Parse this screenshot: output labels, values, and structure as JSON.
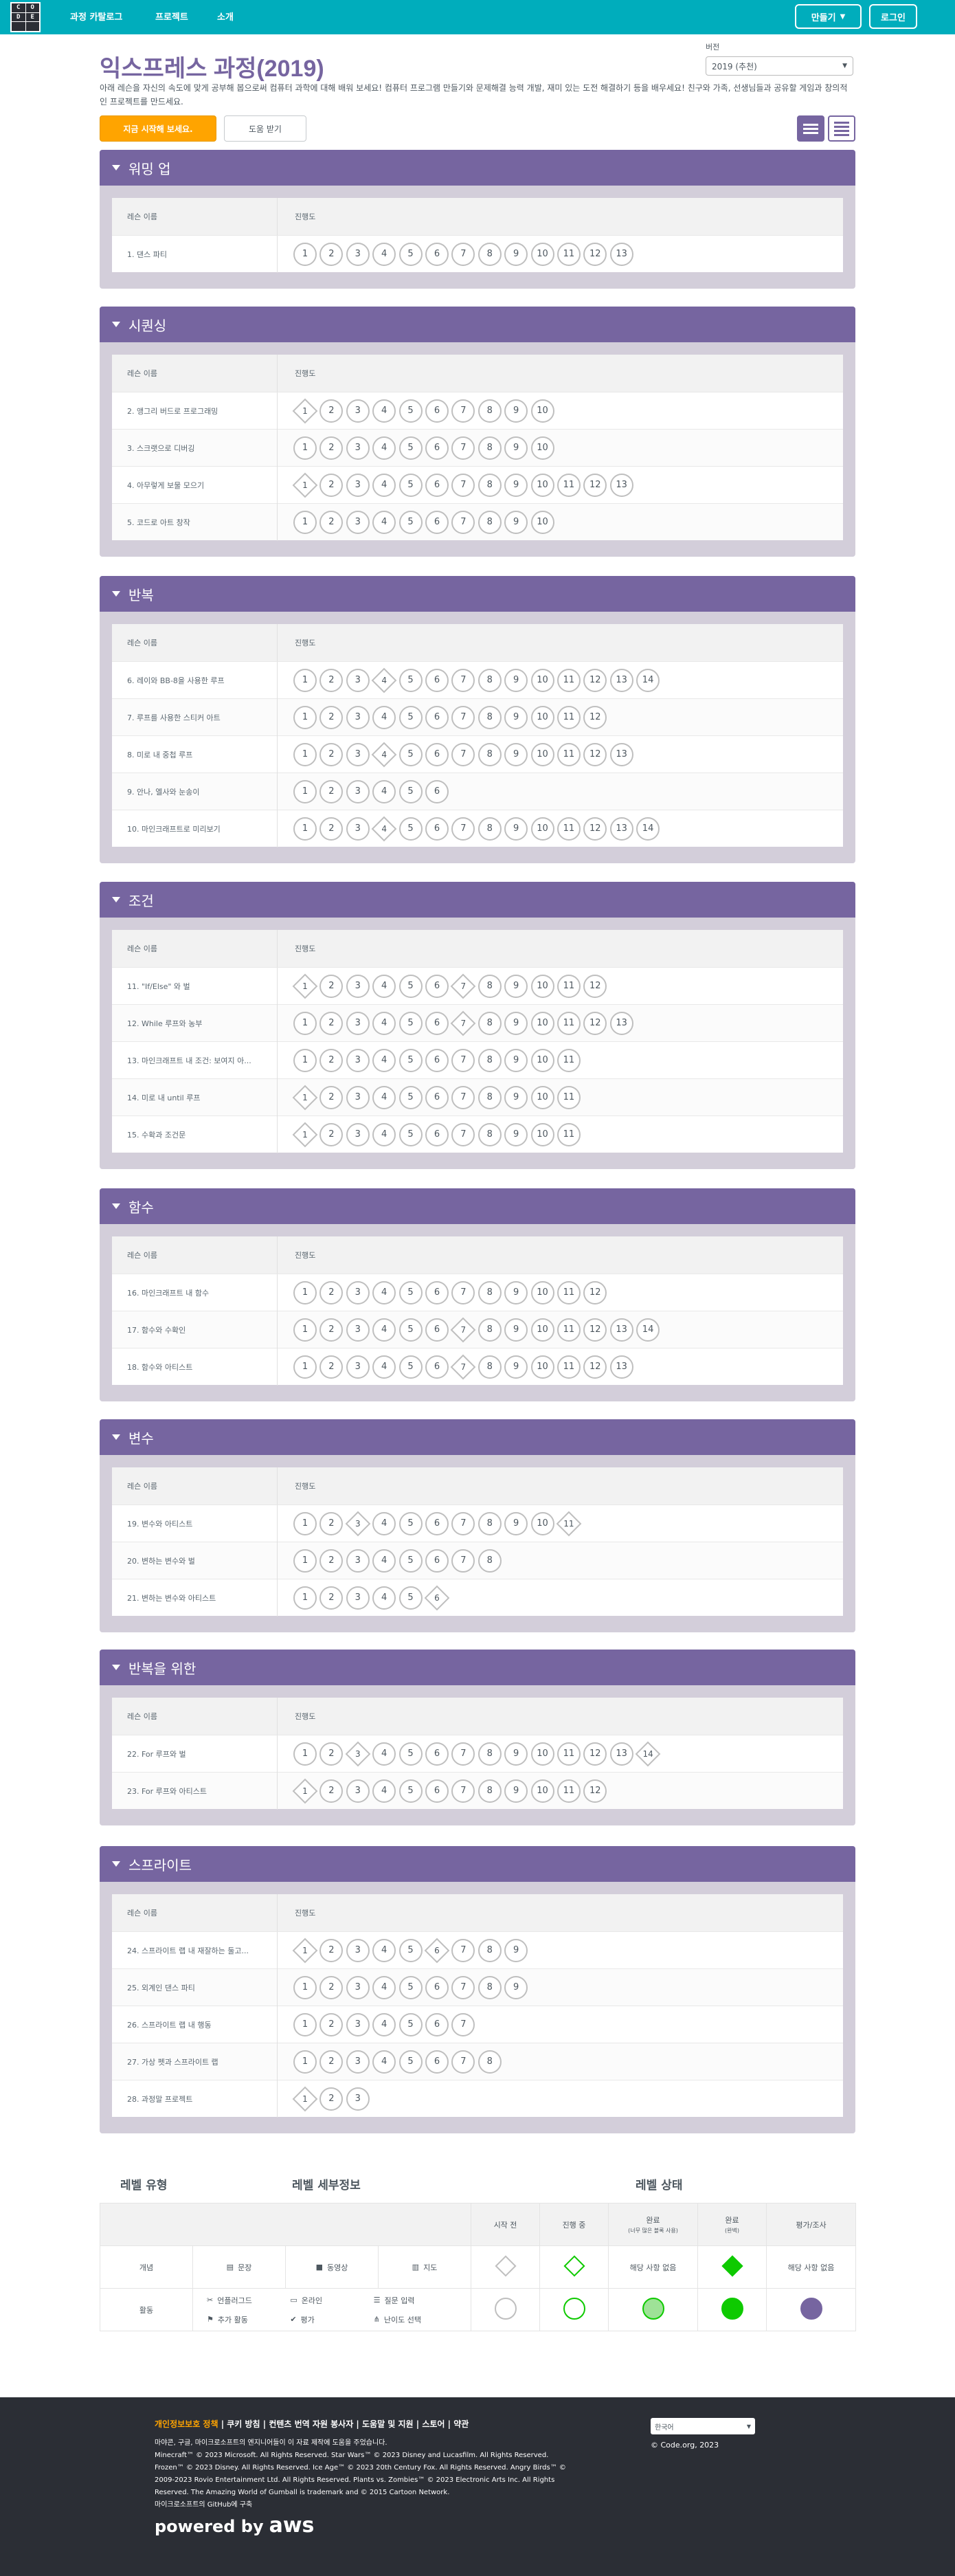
{
  "header": {
    "logo_letters": [
      "C",
      "O",
      "D",
      "E",
      "",
      ""
    ],
    "nav": [
      "과정 카탈로그",
      "프로젝트",
      "소개"
    ],
    "create_btn": "만들기",
    "signin_btn": "로그인"
  },
  "title_prefix": "익스프레스 과정",
  "title_year": "(2019)",
  "description": "아래 레슨을 자신의 속도에 맞게 공부해 봅으로써 컴퓨터 과학에 대해 배워 보세요! 컴퓨터 프로그램 만들기와 문제해결 능력 개발, 재미 있는 도전 해결하기 등을 배우세요! 친구와 가족, 선생님들과 공유할 게임과 창의적인 프로젝트를 만드세요.",
  "version": {
    "label": "버전",
    "selected": "2019 (추천)"
  },
  "buttons": {
    "start": "지금 시작해 보세요.",
    "help": "도움 받기"
  },
  "table_headers": {
    "lesson": "레슨 이름",
    "progress": "진행도"
  },
  "colors": {
    "header": "#00adbc",
    "unit": "#7665a0",
    "start": "#ffa400",
    "complete": "#0eca00"
  },
  "units": [
    {
      "title": "워밍 업",
      "lessons": [
        {
          "name": "1. 댄스 파티",
          "n": 13,
          "diamonds": []
        }
      ]
    },
    {
      "title": "시퀀싱",
      "lessons": [
        {
          "name": "2. 앵그리 버드로 프로그래밍",
          "n": 10,
          "diamonds": [
            1
          ]
        },
        {
          "name": "3. 스크랫으로 디버깅",
          "n": 10,
          "diamonds": []
        },
        {
          "name": "4. 아무렇게 보물 모으기",
          "n": 13,
          "diamonds": [
            1
          ]
        },
        {
          "name": "5. 코드로 아트 창작",
          "n": 10,
          "diamonds": []
        }
      ]
    },
    {
      "title": "반복",
      "lessons": [
        {
          "name": "6. 레이와 BB-8을 사용한 루프",
          "n": 14,
          "diamonds": [
            4
          ]
        },
        {
          "name": "7. 루프를 사용한 스티커 아트",
          "n": 12,
          "diamonds": []
        },
        {
          "name": "8. 미로 내 중첩 루프",
          "n": 13,
          "diamonds": [
            4
          ]
        },
        {
          "name": "9. 안나, 엘사와 눈송이",
          "n": 6,
          "diamonds": []
        },
        {
          "name": "10. 마인크래프트로 미리보기",
          "n": 14,
          "diamonds": [
            4
          ]
        }
      ]
    },
    {
      "title": "조건",
      "lessons": [
        {
          "name": "11. \"If/Else\" 와 벌",
          "n": 12,
          "diamonds": [
            1,
            7
          ]
        },
        {
          "name": "12. While 루프와 농부",
          "n": 13,
          "diamonds": [
            7
          ]
        },
        {
          "name": "13. 마인크래프트 내 조건: 보여지 아...",
          "n": 11,
          "diamonds": []
        },
        {
          "name": "14. 미로 내 until 루프",
          "n": 11,
          "diamonds": [
            1
          ]
        },
        {
          "name": "15. 수확과 조건문",
          "n": 11,
          "diamonds": [
            1
          ]
        }
      ]
    },
    {
      "title": "함수",
      "lessons": [
        {
          "name": "16. 마인크래프트 내 함수",
          "n": 12,
          "diamonds": []
        },
        {
          "name": "17. 함수와 수확인",
          "n": 14,
          "diamonds": [
            7
          ]
        },
        {
          "name": "18. 함수와 아티스트",
          "n": 13,
          "diamonds": [
            7
          ]
        }
      ]
    },
    {
      "title": "변수",
      "lessons": [
        {
          "name": "19. 변수와 아티스트",
          "n": 11,
          "diamonds": [
            3,
            11
          ]
        },
        {
          "name": "20. 변하는 변수와 벌",
          "n": 8,
          "diamonds": []
        },
        {
          "name": "21. 변하는 변수와 아티스트",
          "n": 6,
          "diamonds": [
            6
          ]
        }
      ]
    },
    {
      "title": "반복을 위한",
      "lessons": [
        {
          "name": "22. For 루프와 벌",
          "n": 14,
          "diamonds": [
            3,
            14
          ]
        },
        {
          "name": "23. For 루프와 아티스트",
          "n": 12,
          "diamonds": [
            1
          ]
        }
      ]
    },
    {
      "title": "스프라이트",
      "lessons": [
        {
          "name": "24. 스프라이트 랩 내 재잘하는 둘고...",
          "n": 9,
          "diamonds": [
            1,
            6
          ]
        },
        {
          "name": "25. 외계인 댄스 파티",
          "n": 9,
          "diamonds": []
        },
        {
          "name": "26. 스프라이트 랩 내 행동",
          "n": 7,
          "diamonds": []
        },
        {
          "name": "27. 가상 펫과 스프라이트 랩",
          "n": 8,
          "diamonds": []
        },
        {
          "name": "28. 과정말 프로젝트",
          "n": 3,
          "diamonds": [
            1
          ]
        }
      ]
    }
  ],
  "legend": {
    "level_type": "레벨 유형",
    "level_details": "레벨 세부정보",
    "level_status": "레벨 상태",
    "status_cols": [
      {
        "label": "시작 전",
        "sub": ""
      },
      {
        "label": "진행 중",
        "sub": ""
      },
      {
        "label": "완료",
        "sub": "(너무 많은 블록 사용)"
      },
      {
        "label": "완료",
        "sub": "(완벽)"
      },
      {
        "label": "평가/조사",
        "sub": ""
      }
    ],
    "concept": {
      "label": "개념",
      "items": [
        "문장",
        "동영상",
        "지도"
      ],
      "na": "해당 사항 없음"
    },
    "activity": {
      "label": "활동",
      "items": [
        "언플러그드",
        "온라인",
        "질문 입력",
        "추가 활동",
        "평가",
        "난이도 선택"
      ]
    }
  },
  "footer": {
    "privacy": "개인정보보호 정책",
    "links": "| 쿠키 방침 | 컨텐츠 번역 자원 봉사자 | 도움말 및 지원 | 스토어 | 약관",
    "text": [
      "마야콘, 구글, 마이크로소프트의 엔지니어들이 이 자료 제작에 도움을 주었습니다.",
      "Minecraft™ © 2023 Microsoft. All Rights Reserved. Star Wars™ © 2023 Disney and Lucasfilm. All Rights Reserved.",
      "Frozen™ © 2023 Disney. All Rights Reserved. Ice Age™ © 2023 20th Century Fox. All Rights Reserved. Angry Birds™ ©",
      "2009-2023 Rovio Entertainment Ltd. All Rights Reserved. Plants vs. Zombies™ © 2023 Electronic Arts Inc. All Rights",
      "Reserved. The Amazing World of Gumball is trademark and © 2015 Cartoon Network.",
      "마이크로소프트의 GitHub에 구축"
    ],
    "lang": "한국어",
    "copyright": "© Code.org, 2023",
    "powered": "powered by",
    "aws": "aws"
  }
}
